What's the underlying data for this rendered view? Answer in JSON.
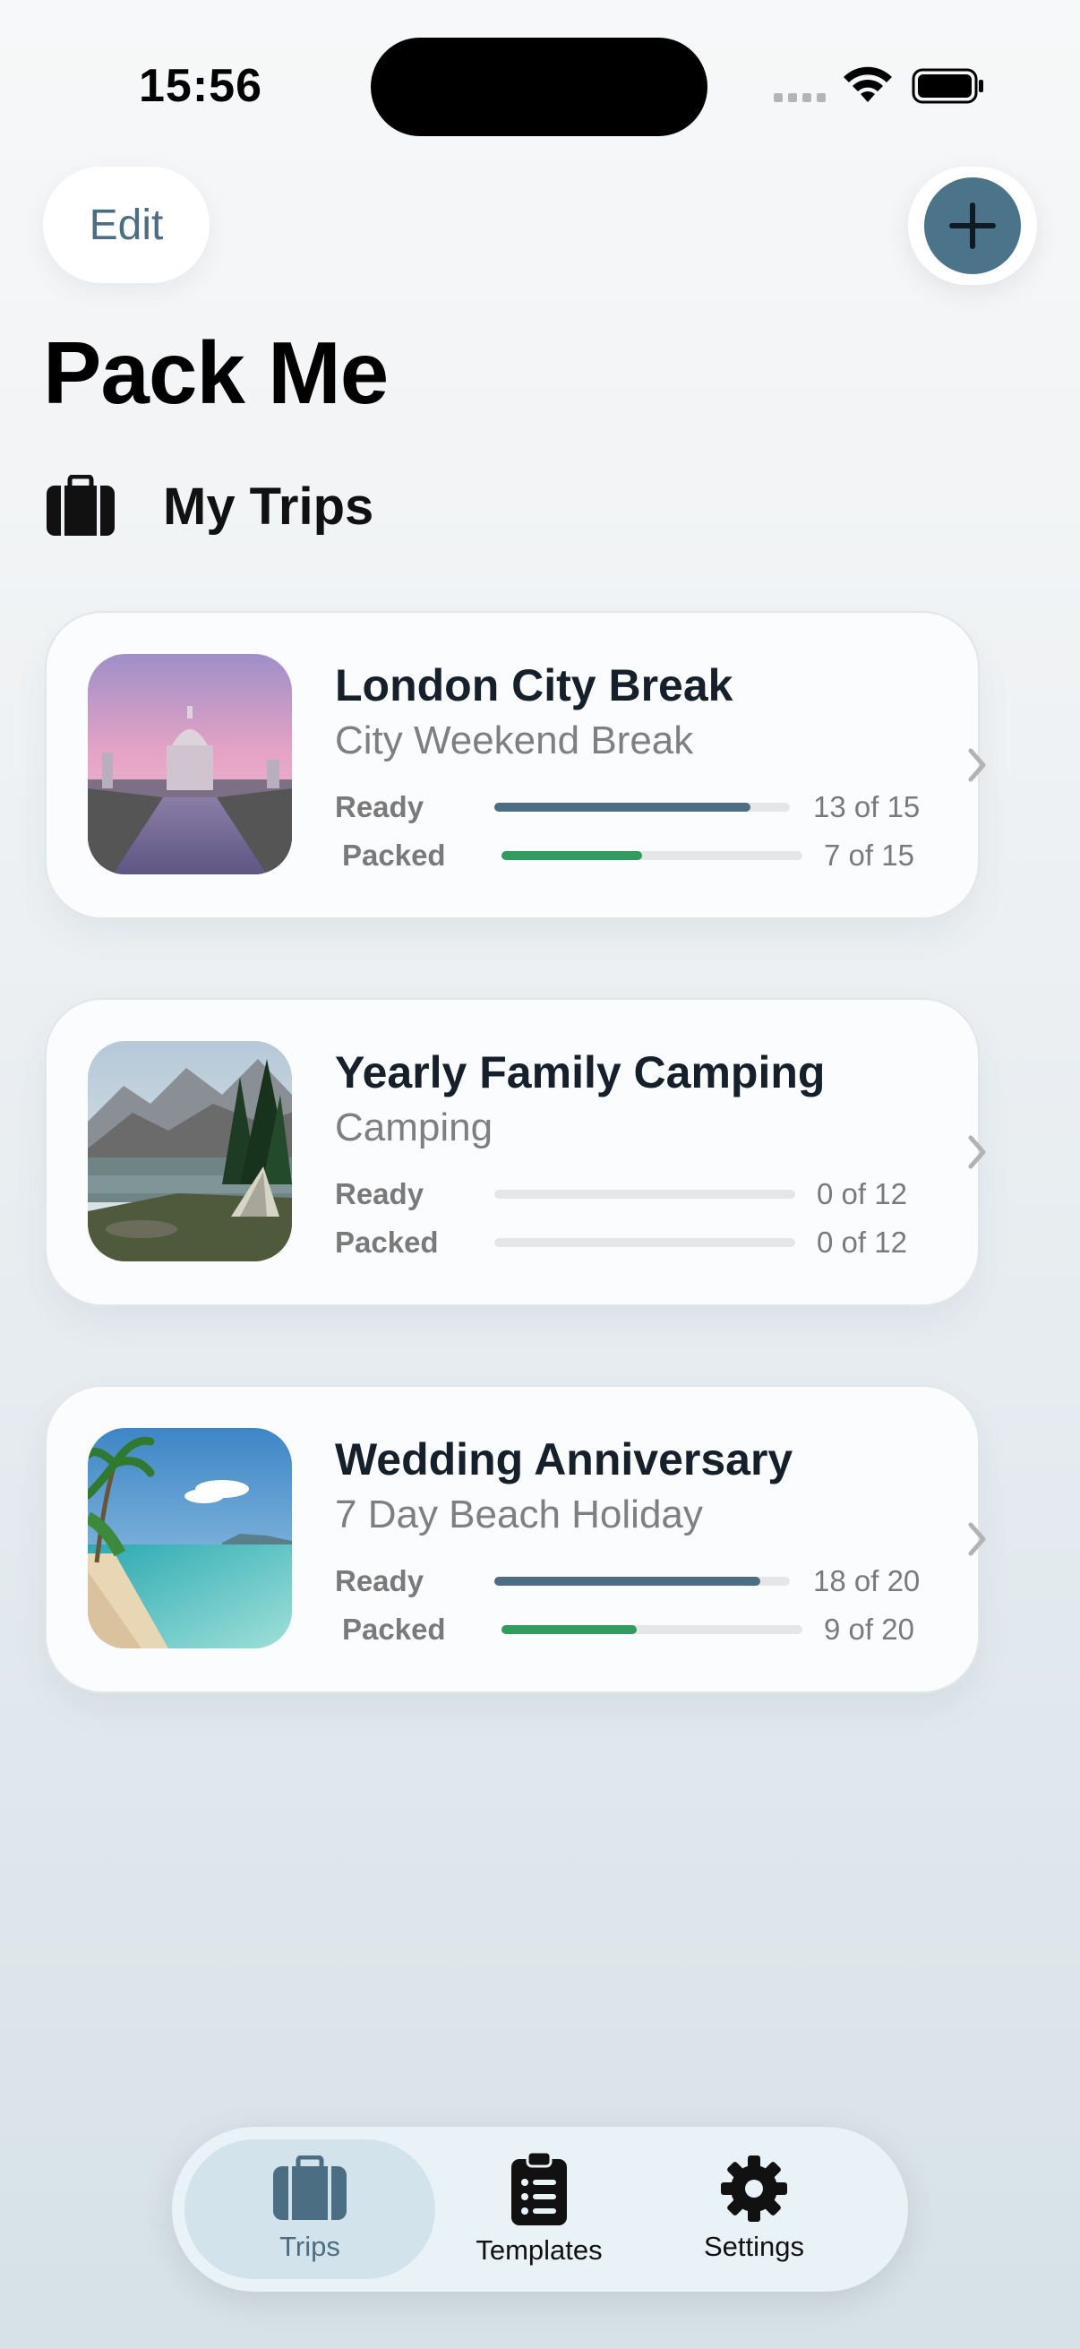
{
  "status_bar": {
    "time": "15:56"
  },
  "header": {
    "edit_label": "Edit",
    "add_icon": "plus-icon",
    "title": "Pack Me"
  },
  "section": {
    "icon": "suitcase-icon",
    "title": "My Trips"
  },
  "colors": {
    "accent": "#4b6e82",
    "ready_bar": "#4b6e82",
    "packed_bar": "#2f9d5e"
  },
  "trips": [
    {
      "name": "London City Break",
      "type": "City Weekend Break",
      "ready_label": "Ready",
      "ready_count": "13 of 15",
      "ready_fraction": 0.867,
      "packed_label": "Packed",
      "packed_count": "7 of 15",
      "packed_fraction": 0.467
    },
    {
      "name": "Yearly Family Camping",
      "type": "Camping",
      "ready_label": "Ready",
      "ready_count": "0 of 12",
      "ready_fraction": 0,
      "packed_label": "Packed",
      "packed_count": "0 of 12",
      "packed_fraction": 0
    },
    {
      "name": "Wedding Anniversary",
      "type": "7 Day Beach Holiday",
      "ready_label": "Ready",
      "ready_count": "18 of 20",
      "ready_fraction": 0.9,
      "packed_label": "Packed",
      "packed_count": "9 of 20",
      "packed_fraction": 0.45
    }
  ],
  "tab_bar": {
    "tabs": [
      {
        "label": "Trips",
        "icon": "suitcase-icon",
        "active": true
      },
      {
        "label": "Templates",
        "icon": "clipboard-list-icon",
        "active": false
      },
      {
        "label": "Settings",
        "icon": "gear-icon",
        "active": false
      }
    ]
  }
}
